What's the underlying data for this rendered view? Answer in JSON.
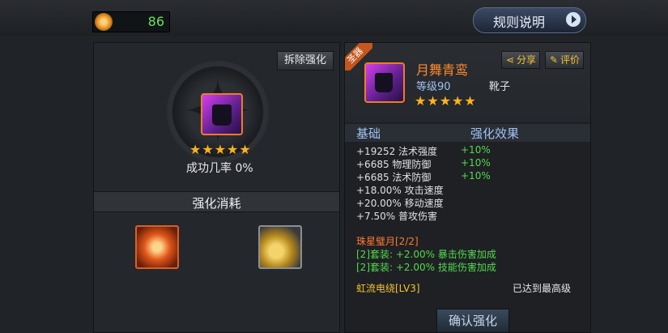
{
  "resource": {
    "icon": "flame-coin-icon",
    "value": "86"
  },
  "rules_button": {
    "label": "规则说明",
    "icon": "arrow-right-icon"
  },
  "left_panel": {
    "dismantle_label": "拆除强化",
    "stars": "★★★★★",
    "success_rate": "成功几率 0%",
    "cost_title": "强化消耗",
    "materials": [
      "strengthen-stone-icon",
      "gold-coins-icon"
    ]
  },
  "right_panel": {
    "ribbon": "圣器",
    "item": {
      "name": "月舞青鸾",
      "level": "等级90",
      "type": "靴子",
      "stars": "★★★★★",
      "icon": "boots-icon"
    },
    "share_label": "分享",
    "rate_label": "评价",
    "headers": {
      "base": "基础",
      "effect": "强化效果"
    },
    "stats": [
      {
        "base": "+19252 法术强度",
        "effect": "+10%"
      },
      {
        "base": "+6685 物理防御",
        "effect": "+10%"
      },
      {
        "base": "+6685 法术防御",
        "effect": "+10%"
      },
      {
        "base": "+18.00% 攻击速度",
        "effect": ""
      },
      {
        "base": "+20.00% 移动速度",
        "effect": ""
      },
      {
        "base": "+7.50% 普攻伤害",
        "effect": ""
      }
    ],
    "set": {
      "title": "珠星璧月[2/2]",
      "bonuses": [
        "[2]套装: +2.00% 暴击伤害加成",
        "[2]套装: +2.00% 技能伤害加成"
      ]
    },
    "skill": {
      "name": "虹流电绕[LV3]",
      "status": "已达到最高级"
    },
    "confirm_label": "确认强化"
  }
}
